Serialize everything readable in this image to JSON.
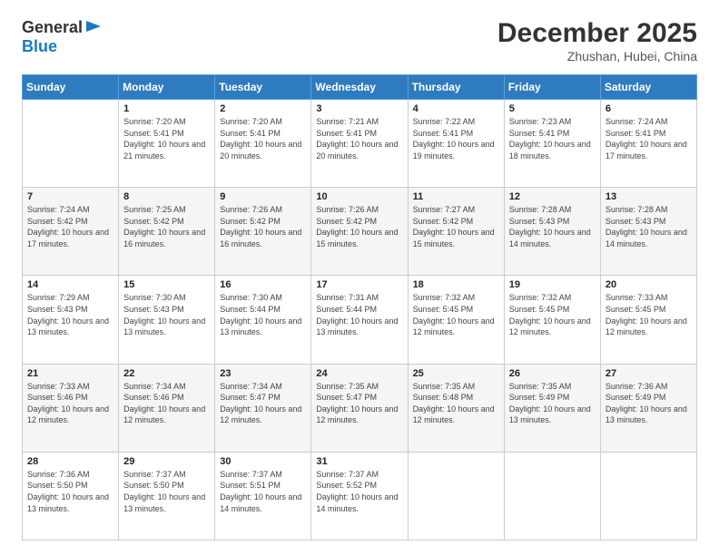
{
  "logo": {
    "general": "General",
    "blue": "Blue"
  },
  "header": {
    "month_year": "December 2025",
    "location": "Zhushan, Hubei, China"
  },
  "days_of_week": [
    "Sunday",
    "Monday",
    "Tuesday",
    "Wednesday",
    "Thursday",
    "Friday",
    "Saturday"
  ],
  "weeks": [
    [
      {
        "day": "",
        "sunrise": "",
        "sunset": "",
        "daylight": ""
      },
      {
        "day": "1",
        "sunrise": "Sunrise: 7:20 AM",
        "sunset": "Sunset: 5:41 PM",
        "daylight": "Daylight: 10 hours and 21 minutes."
      },
      {
        "day": "2",
        "sunrise": "Sunrise: 7:20 AM",
        "sunset": "Sunset: 5:41 PM",
        "daylight": "Daylight: 10 hours and 20 minutes."
      },
      {
        "day": "3",
        "sunrise": "Sunrise: 7:21 AM",
        "sunset": "Sunset: 5:41 PM",
        "daylight": "Daylight: 10 hours and 20 minutes."
      },
      {
        "day": "4",
        "sunrise": "Sunrise: 7:22 AM",
        "sunset": "Sunset: 5:41 PM",
        "daylight": "Daylight: 10 hours and 19 minutes."
      },
      {
        "day": "5",
        "sunrise": "Sunrise: 7:23 AM",
        "sunset": "Sunset: 5:41 PM",
        "daylight": "Daylight: 10 hours and 18 minutes."
      },
      {
        "day": "6",
        "sunrise": "Sunrise: 7:24 AM",
        "sunset": "Sunset: 5:41 PM",
        "daylight": "Daylight: 10 hours and 17 minutes."
      }
    ],
    [
      {
        "day": "7",
        "sunrise": "Sunrise: 7:24 AM",
        "sunset": "Sunset: 5:42 PM",
        "daylight": "Daylight: 10 hours and 17 minutes."
      },
      {
        "day": "8",
        "sunrise": "Sunrise: 7:25 AM",
        "sunset": "Sunset: 5:42 PM",
        "daylight": "Daylight: 10 hours and 16 minutes."
      },
      {
        "day": "9",
        "sunrise": "Sunrise: 7:26 AM",
        "sunset": "Sunset: 5:42 PM",
        "daylight": "Daylight: 10 hours and 16 minutes."
      },
      {
        "day": "10",
        "sunrise": "Sunrise: 7:26 AM",
        "sunset": "Sunset: 5:42 PM",
        "daylight": "Daylight: 10 hours and 15 minutes."
      },
      {
        "day": "11",
        "sunrise": "Sunrise: 7:27 AM",
        "sunset": "Sunset: 5:42 PM",
        "daylight": "Daylight: 10 hours and 15 minutes."
      },
      {
        "day": "12",
        "sunrise": "Sunrise: 7:28 AM",
        "sunset": "Sunset: 5:43 PM",
        "daylight": "Daylight: 10 hours and 14 minutes."
      },
      {
        "day": "13",
        "sunrise": "Sunrise: 7:28 AM",
        "sunset": "Sunset: 5:43 PM",
        "daylight": "Daylight: 10 hours and 14 minutes."
      }
    ],
    [
      {
        "day": "14",
        "sunrise": "Sunrise: 7:29 AM",
        "sunset": "Sunset: 5:43 PM",
        "daylight": "Daylight: 10 hours and 13 minutes."
      },
      {
        "day": "15",
        "sunrise": "Sunrise: 7:30 AM",
        "sunset": "Sunset: 5:43 PM",
        "daylight": "Daylight: 10 hours and 13 minutes."
      },
      {
        "day": "16",
        "sunrise": "Sunrise: 7:30 AM",
        "sunset": "Sunset: 5:44 PM",
        "daylight": "Daylight: 10 hours and 13 minutes."
      },
      {
        "day": "17",
        "sunrise": "Sunrise: 7:31 AM",
        "sunset": "Sunset: 5:44 PM",
        "daylight": "Daylight: 10 hours and 13 minutes."
      },
      {
        "day": "18",
        "sunrise": "Sunrise: 7:32 AM",
        "sunset": "Sunset: 5:45 PM",
        "daylight": "Daylight: 10 hours and 12 minutes."
      },
      {
        "day": "19",
        "sunrise": "Sunrise: 7:32 AM",
        "sunset": "Sunset: 5:45 PM",
        "daylight": "Daylight: 10 hours and 12 minutes."
      },
      {
        "day": "20",
        "sunrise": "Sunrise: 7:33 AM",
        "sunset": "Sunset: 5:45 PM",
        "daylight": "Daylight: 10 hours and 12 minutes."
      }
    ],
    [
      {
        "day": "21",
        "sunrise": "Sunrise: 7:33 AM",
        "sunset": "Sunset: 5:46 PM",
        "daylight": "Daylight: 10 hours and 12 minutes."
      },
      {
        "day": "22",
        "sunrise": "Sunrise: 7:34 AM",
        "sunset": "Sunset: 5:46 PM",
        "daylight": "Daylight: 10 hours and 12 minutes."
      },
      {
        "day": "23",
        "sunrise": "Sunrise: 7:34 AM",
        "sunset": "Sunset: 5:47 PM",
        "daylight": "Daylight: 10 hours and 12 minutes."
      },
      {
        "day": "24",
        "sunrise": "Sunrise: 7:35 AM",
        "sunset": "Sunset: 5:47 PM",
        "daylight": "Daylight: 10 hours and 12 minutes."
      },
      {
        "day": "25",
        "sunrise": "Sunrise: 7:35 AM",
        "sunset": "Sunset: 5:48 PM",
        "daylight": "Daylight: 10 hours and 12 minutes."
      },
      {
        "day": "26",
        "sunrise": "Sunrise: 7:35 AM",
        "sunset": "Sunset: 5:49 PM",
        "daylight": "Daylight: 10 hours and 13 minutes."
      },
      {
        "day": "27",
        "sunrise": "Sunrise: 7:36 AM",
        "sunset": "Sunset: 5:49 PM",
        "daylight": "Daylight: 10 hours and 13 minutes."
      }
    ],
    [
      {
        "day": "28",
        "sunrise": "Sunrise: 7:36 AM",
        "sunset": "Sunset: 5:50 PM",
        "daylight": "Daylight: 10 hours and 13 minutes."
      },
      {
        "day": "29",
        "sunrise": "Sunrise: 7:37 AM",
        "sunset": "Sunset: 5:50 PM",
        "daylight": "Daylight: 10 hours and 13 minutes."
      },
      {
        "day": "30",
        "sunrise": "Sunrise: 7:37 AM",
        "sunset": "Sunset: 5:51 PM",
        "daylight": "Daylight: 10 hours and 14 minutes."
      },
      {
        "day": "31",
        "sunrise": "Sunrise: 7:37 AM",
        "sunset": "Sunset: 5:52 PM",
        "daylight": "Daylight: 10 hours and 14 minutes."
      },
      {
        "day": "",
        "sunrise": "",
        "sunset": "",
        "daylight": ""
      },
      {
        "day": "",
        "sunrise": "",
        "sunset": "",
        "daylight": ""
      },
      {
        "day": "",
        "sunrise": "",
        "sunset": "",
        "daylight": ""
      }
    ]
  ]
}
